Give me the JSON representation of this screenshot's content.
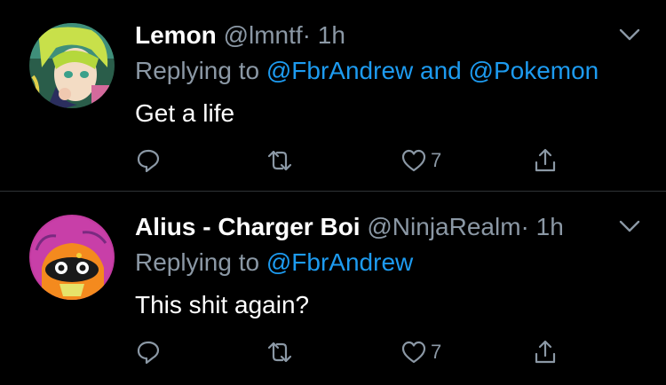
{
  "tweets": [
    {
      "name": "Lemon",
      "handle": "@lmntf",
      "dot": "·",
      "time": "1h",
      "reply_prefix": "Replying to",
      "mentions": [
        "@FbrAndrew",
        "@Pokemon"
      ],
      "mention_joiner": "and",
      "text": "Get a life",
      "like_count": "7",
      "avatar_icon": "anime-girl-avatar"
    },
    {
      "name": "Alius - Charger Boi",
      "handle": "@NinjaRealm",
      "dot": "·",
      "time": "1h",
      "reply_prefix": "Replying to",
      "mentions": [
        "@FbrAndrew"
      ],
      "text": "This shit again?",
      "like_count": "7",
      "avatar_icon": "inkling-avatar"
    }
  ],
  "colors": {
    "background": "#000000",
    "primary_text": "#ffffff",
    "secondary_text": "#8b98a5",
    "link": "#1d9bf0",
    "divider": "#2f3336"
  },
  "icons": [
    "reply-icon",
    "retweet-icon",
    "like-icon",
    "share-icon",
    "chevron-down-icon"
  ]
}
